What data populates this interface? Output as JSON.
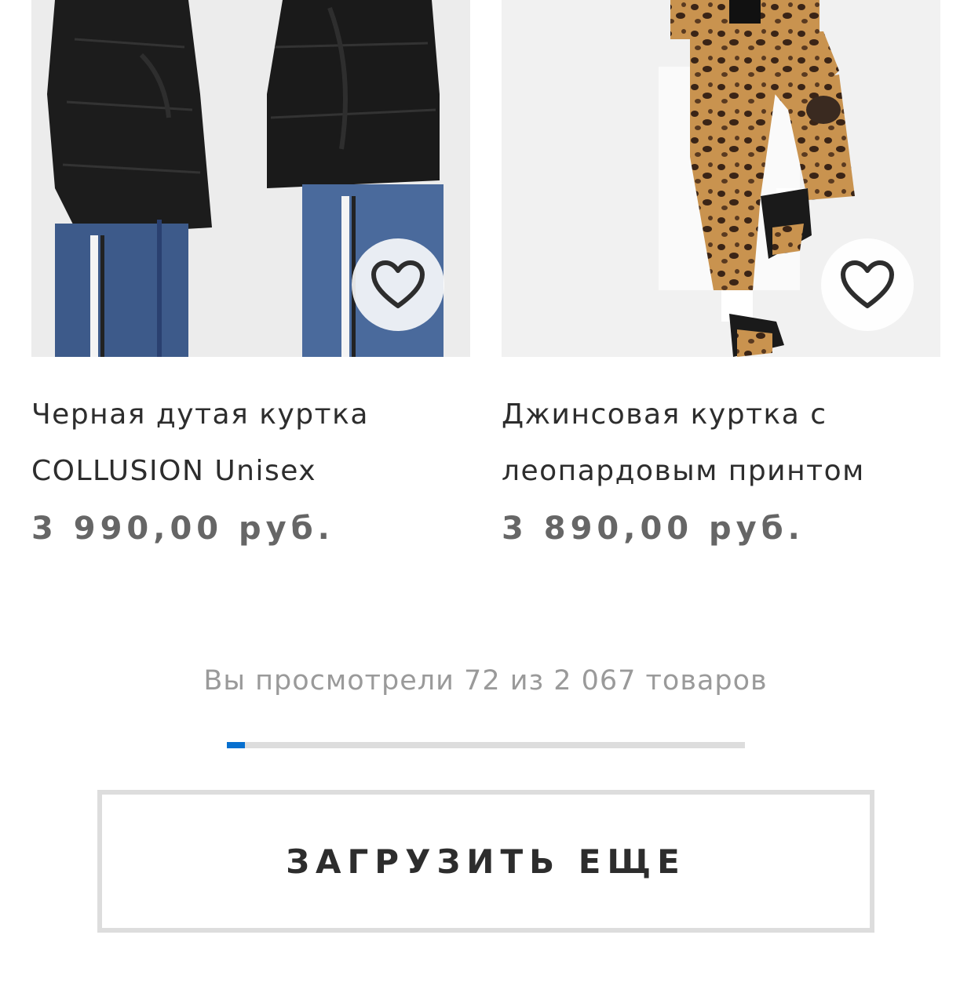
{
  "products": [
    {
      "title": "Черная дутая куртка\nCOLLUSION Unisex",
      "price": "3 990,00 руб.",
      "favorite_icon": "heart-outline-icon"
    },
    {
      "title": "Джинсовая куртка с\nлеопардовым принтом",
      "price": "3 890,00 руб.",
      "favorite_icon": "heart-outline-icon"
    }
  ],
  "pagination": {
    "viewed_text": "Вы просмотрели 72 из 2 067 товаров",
    "viewed": 72,
    "total": 2067
  },
  "load_more": {
    "label": "ЗАГРУЗИТЬ ЕЩЕ"
  },
  "colors": {
    "progress_fill": "#0770cf",
    "progress_track": "#dddddd",
    "price_text": "#666666",
    "button_border": "#dddddd"
  }
}
